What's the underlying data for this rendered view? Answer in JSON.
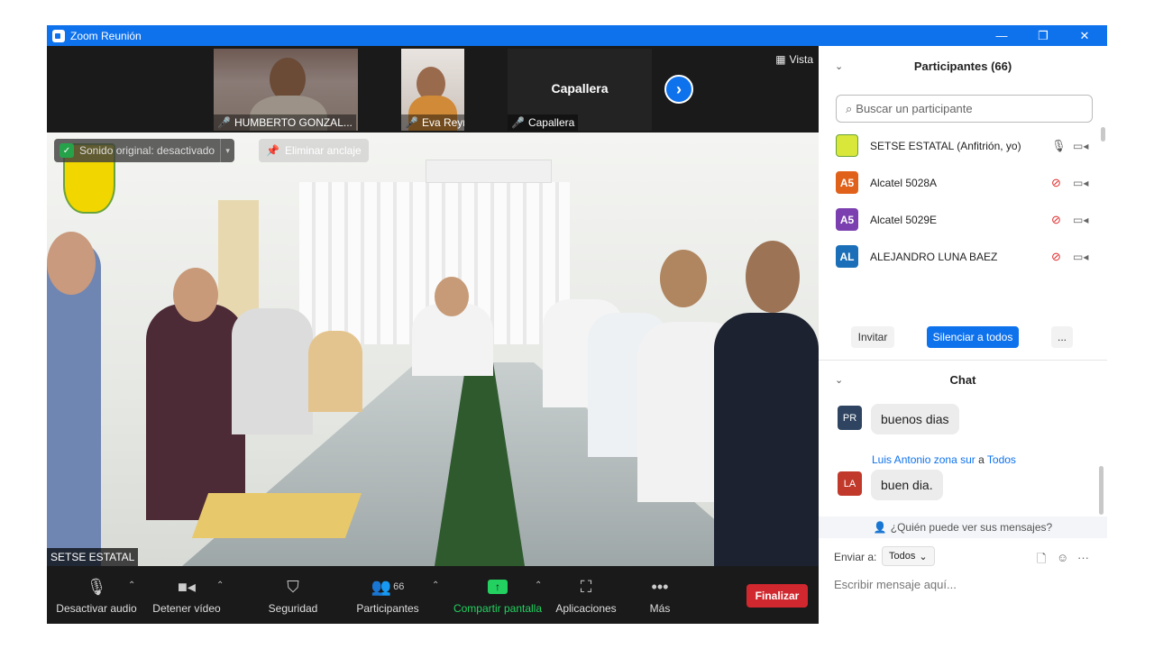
{
  "window": {
    "title": "Zoom Reunión",
    "controls": [
      "—",
      "❐",
      "✕"
    ]
  },
  "thumbnails": [
    {
      "name": "HUMBERTO GONZAL..."
    },
    {
      "name": "Eva Reyna Ruíz"
    },
    {
      "name": "Capallera",
      "center_label": "Capallera"
    }
  ],
  "view_button": "Vista",
  "main_video": {
    "sound_status": "Sonido original: desactivado",
    "unpin_label": "Eliminar anclaje",
    "speaker_name": "SETSE ESTATAL"
  },
  "toolbar": {
    "mute": "Desactivar audio",
    "video": "Detener vídeo",
    "security": "Seguridad",
    "participants": "Participantes",
    "participants_count": "66",
    "share": "Compartir pantalla",
    "apps": "Aplicaciones",
    "more": "Más",
    "end": "Finalizar"
  },
  "participants_panel": {
    "title": "Participantes (66)",
    "search_placeholder": "Buscar un participante",
    "list": [
      {
        "initials": "",
        "name": "SETSE ESTATAL (Anfitrión, yo)",
        "color": "#d9e63a",
        "muted": false
      },
      {
        "initials": "A5",
        "name": "Alcatel 5028A",
        "color": "#e0611a",
        "muted": true
      },
      {
        "initials": "A5",
        "name": "Alcatel 5029E",
        "color": "#7b3fb0",
        "muted": true
      },
      {
        "initials": "AL",
        "name": "ALEJANDRO LUNA BAEZ",
        "color": "#1a6fb8",
        "muted": true
      }
    ],
    "invite": "Invitar",
    "mute_all": "Silenciar a todos",
    "more": "..."
  },
  "chat_panel": {
    "title": "Chat",
    "messages": [
      {
        "initials": "PR",
        "color": "#2e4460",
        "sender": "",
        "text": "buenos dias"
      },
      {
        "initials": "LA",
        "color": "#c0392b",
        "sender": "Luis Antonio zona sur",
        "to_word": "a",
        "to": "Todos",
        "text": "buen dia."
      }
    ],
    "who_can_see": "¿Quién puede ver sus mensajes?",
    "send_to_label": "Enviar a:",
    "send_to_value": "Todos",
    "input_placeholder": "Escribir mensaje aquí..."
  }
}
